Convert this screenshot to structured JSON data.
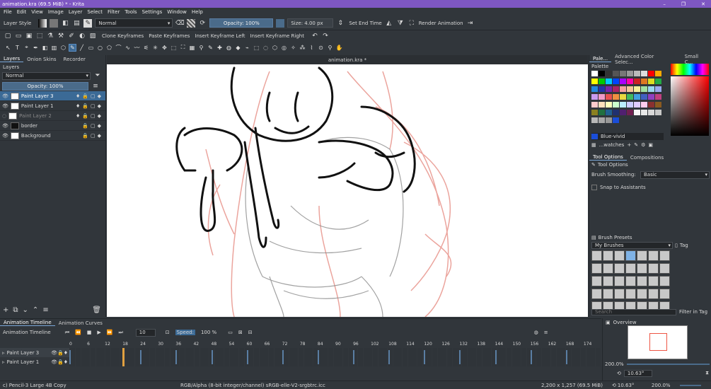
{
  "window": {
    "title": "animation.kra (69.5 MiB) * - Krita",
    "controls": [
      "–",
      "❐",
      "✕"
    ]
  },
  "menu": [
    "File",
    "Edit",
    "View",
    "Image",
    "Layer",
    "Select",
    "Filter",
    "Tools",
    "Settings",
    "Window",
    "Help"
  ],
  "toolbar": {
    "layer_style": "Layer Style",
    "blend_mode": "Normal",
    "opacity": "Opacity: 100%",
    "size": "Size: 4.00 px",
    "set_end_time": "Set End Time",
    "render_animation": "Render Animation"
  },
  "toolbar2": {
    "clone": "Clone Keyframes",
    "paste": "Paste Keyframes",
    "insert_left": "Insert Keyframe Left",
    "insert_right": "Insert Keyframe Right"
  },
  "left_dock": {
    "tabs": [
      "Layers",
      "Onion Skins",
      "Recorder"
    ],
    "panel_title": "Layers",
    "blend": "Normal",
    "opacity": "Opacity:  100%",
    "layers": [
      {
        "name": "Paint Layer 3",
        "selected": true
      },
      {
        "name": "Paint Layer 1",
        "selected": false
      },
      {
        "name": "Paint Layer 2",
        "selected": false
      },
      {
        "name": "border",
        "selected": false
      },
      {
        "name": "Background",
        "selected": false
      }
    ]
  },
  "canvas": {
    "tab": "animation.kra *"
  },
  "right_dock": {
    "tabs": [
      "Pale...",
      "Advanced Color Selec...",
      "Small C..."
    ],
    "palette_title": "Palette",
    "color_name": "Blue-vivid",
    "swatches_label": "...watches",
    "tool_tabs": [
      "Tool Options",
      "Compositions"
    ],
    "tool_options_title": "Tool Options",
    "brush_smoothing_label": "Brush Smoothing:",
    "brush_smoothing_value": "Basic",
    "snap": "Snap to Assistants",
    "brush_presets_title": "Brush Presets",
    "brush_tag": "My Brushes",
    "tag_label": "Tag",
    "search_placeholder": "Search",
    "filter_in_tag": "Filter in Tag"
  },
  "timeline": {
    "tabs": [
      "Animation Timeline",
      "Animation Curves"
    ],
    "title": "Animation Timeline",
    "frame": "10",
    "speed_label": "Speed:",
    "speed_value": "100 %",
    "ruler": [
      "0",
      "6",
      "12",
      "18",
      "24",
      "30",
      "36",
      "42",
      "48",
      "54",
      "60",
      "66",
      "72",
      "78",
      "84",
      "90",
      "96",
      "102",
      "108",
      "114",
      "120",
      "126",
      "132",
      "138",
      "144",
      "150",
      "156",
      "162",
      "168",
      "174"
    ],
    "layers": [
      "Paint Layer 3",
      "Paint Layer 1"
    ]
  },
  "overview": {
    "title": "Overview",
    "zoom": "200.0%",
    "angle": "10.63°"
  },
  "status": {
    "brush": "c) Pencil-3 Large 4B Copy",
    "color_space": "RGB/Alpha (8-bit integer/channel)  sRGB-elle-V2-srgbtrc.icc",
    "size": "2,200 x 1,257 (69.5 MiB)",
    "angle": "10.63°",
    "zoom": "200.0%"
  },
  "colors": {
    "accent": "#3b6a96",
    "titlebar": "#7e57c2",
    "panel": "#31363b",
    "stroke_red": "#e8958c",
    "stroke_black": "#111111",
    "stroke_gray": "#8a8a8a"
  }
}
